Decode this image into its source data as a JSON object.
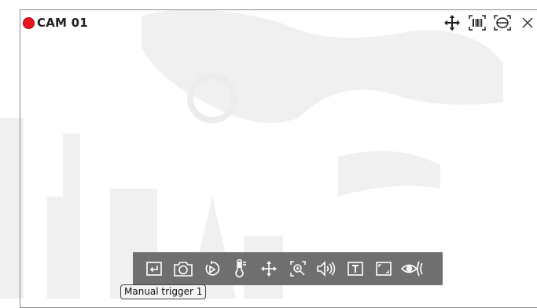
{
  "camera": {
    "name": "CAM 01",
    "status_color": "#e8141e"
  },
  "top_controls": [
    {
      "icon": "move-arrows-icon"
    },
    {
      "icon": "barcode-scan-icon"
    },
    {
      "icon": "fisheye-dewarp-icon"
    },
    {
      "icon": "close-icon"
    }
  ],
  "toolbar": {
    "buttons": [
      {
        "icon": "manual-trigger-icon"
      },
      {
        "icon": "camera-snapshot-icon"
      },
      {
        "icon": "instant-replay-icon"
      },
      {
        "icon": "thermometer-icon"
      },
      {
        "icon": "ptz-move-icon"
      },
      {
        "icon": "digital-zoom-icon"
      },
      {
        "icon": "audio-speaker-icon"
      },
      {
        "icon": "text-overlay-icon"
      },
      {
        "icon": "aspect-ratio-icon"
      },
      {
        "icon": "privacy-eye-icon"
      }
    ]
  },
  "tooltip": {
    "text": "Manual trigger 1"
  },
  "colors": {
    "toolbar_bg": "#6f6f6f",
    "icon": "#ffffff",
    "watermark": "#ededed"
  }
}
